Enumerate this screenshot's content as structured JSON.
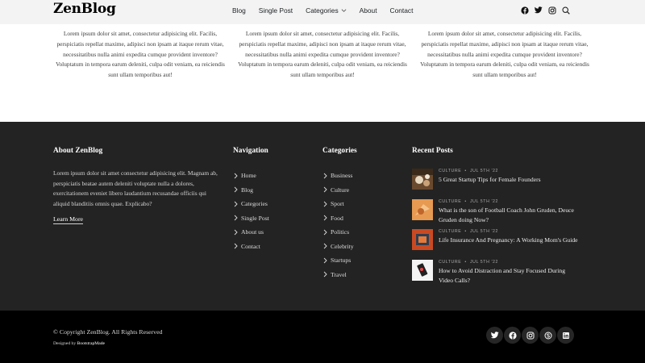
{
  "header": {
    "logo": "ZenBlog",
    "nav": [
      "Blog",
      "Single Post",
      "Categories",
      "About",
      "Contact"
    ],
    "icons": [
      "facebook-icon",
      "twitter-icon",
      "instagram-icon",
      "search-icon"
    ]
  },
  "text_columns": [
    "Lorem ipsum dolor sit amet, consectetur adipisicing elit. Facilis, perspiciatis repellat maxime, adipisci non ipsam at itaque rerum vitae, necessitatibus nulla animi expedita cumque provident inventore? Voluptatum in tempora earum deleniti, culpa odit veniam, ea reiciendis sunt ullam temporibus aut!",
    "Lorem ipsum dolor sit amet, consectetur adipisicing elit. Facilis, perspiciatis repellat maxime, adipisci non ipsam at itaque rerum vitae, necessitatibus nulla animi expedita cumque provident inventore? Voluptatum in tempora earum deleniti, culpa odit veniam, ea reiciendis sunt ullam temporibus aut!",
    "Lorem ipsum dolor sit amet, consectetur adipisicing elit. Facilis, perspiciatis repellat maxime, adipisci non ipsam at itaque rerum vitae, necessitatibus nulla animi expedita cumque provident inventore? Voluptatum in tempora earum deleniti, culpa odit veniam, ea reiciendis sunt ullam temporibus aut!"
  ],
  "footer": {
    "about": {
      "heading": "About ZenBlog",
      "text": "Lorem ipsum dolor sit amet consectetur adipisicing elit. Magnam ab, perspiciatis beatae autem deleniti voluptate nulla a dolores, exercitationem eveniet libero laudantium recusandae officiis qui aliquid blanditiis omnis quae. Explicabo?",
      "link": "Learn More"
    },
    "navigation": {
      "heading": "Navigation",
      "items": [
        "Home",
        "Blog",
        "Categories",
        "Single Post",
        "About us",
        "Contact"
      ]
    },
    "categories": {
      "heading": "Categories",
      "items": [
        "Business",
        "Culture",
        "Sport",
        "Food",
        "Politics",
        "Celebrity",
        "Startups",
        "Travel"
      ]
    },
    "recent": {
      "heading": "Recent Posts",
      "posts": [
        {
          "category": "CULTURE",
          "dot": "•",
          "date": "JUL 5TH '22",
          "title": "5 Great Startup Tips for Female Founders"
        },
        {
          "category": "CULTURE",
          "dot": "•",
          "date": "JUL 5TH '22",
          "title": "What is the son of Football Coach John Gruden, Deuce Gruden doing Now?"
        },
        {
          "category": "CULTURE",
          "dot": "•",
          "date": "JUL 5TH '22",
          "title": "Life Insurance And Pregnancy: A Working Mom's Guide"
        },
        {
          "category": "CULTURE",
          "dot": "•",
          "date": "JUL 5TH '22",
          "title": "How to Avoid Distraction and Stay Focused During Video Calls?"
        }
      ]
    },
    "copyright": "© Copyright ZenBlog. All Rights Reserved",
    "designed_prefix": "Designed by ",
    "designed_brand": "BootstrapMade",
    "social": [
      "twitter-icon",
      "facebook-icon",
      "instagram-icon",
      "skype-icon",
      "linkedin-icon"
    ]
  }
}
